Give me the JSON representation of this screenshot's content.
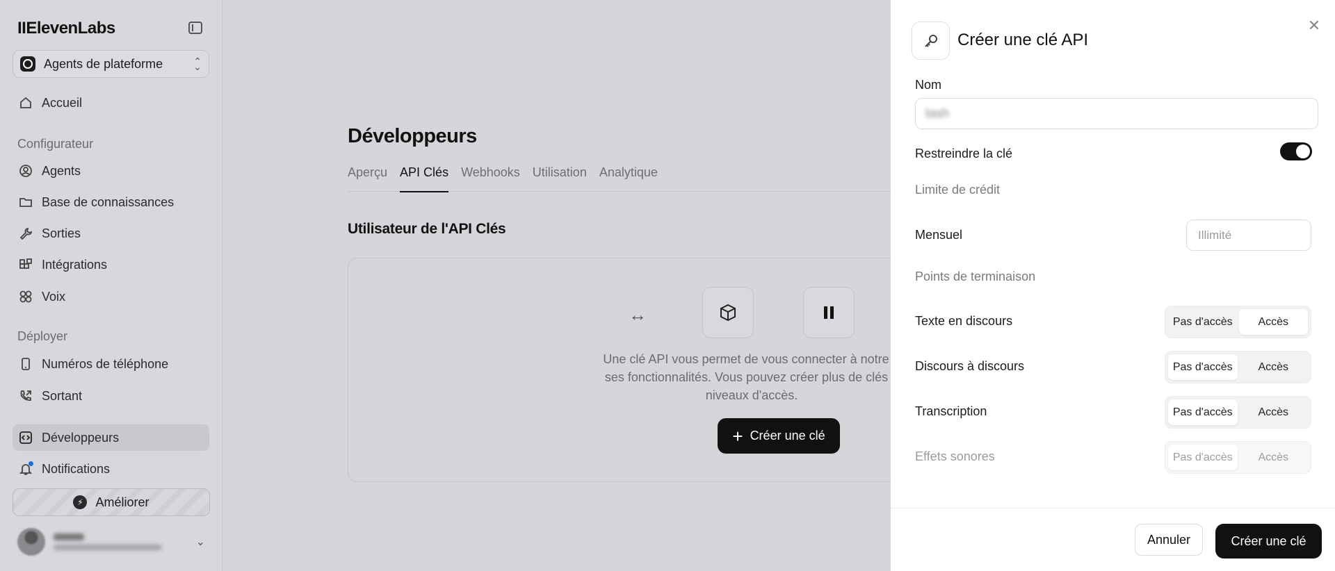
{
  "sidebar": {
    "logo": "IIElevenLabs",
    "workspace": "Agents de plateforme",
    "home": "Accueil",
    "section_config": "Configurateur",
    "items_config": [
      "Agents",
      "Base de connaissances",
      "Sorties",
      "Intégrations",
      "Voix"
    ],
    "section_deploy": "Déployer",
    "items_deploy": [
      "Numéros de téléphone",
      "Sortant"
    ],
    "developers": "Développeurs",
    "notifications": "Notifications",
    "upgrade": "Améliorer"
  },
  "main": {
    "title": "Développeurs",
    "tabs": [
      "Aperçu",
      "API Clés",
      "Webhooks",
      "Utilisation",
      "Analytique"
    ],
    "active_tab": "API Clés",
    "section_title": "Utilisateur de l'API Clés",
    "empty_line1": "Une clé API vous permet de vous connecter à notre A",
    "empty_line2": "ses fonctionnalités. Vous pouvez créer plus de clés a",
    "empty_line3": "niveaux d'accès.",
    "create_button": "Créer une clé",
    "arrow": "↔"
  },
  "drawer": {
    "title": "Créer une clé API",
    "name_label": "Nom",
    "name_value": "tash",
    "restrict_label": "Restreindre la clé",
    "restrict_on": true,
    "credit_limit_label": "Limite de crédit",
    "monthly_label": "Mensuel",
    "monthly_placeholder": "Illimité",
    "endpoints_label": "Points de terminaison",
    "endpoints": [
      {
        "label": "Texte en discours",
        "selected": "Accès",
        "disabled": false
      },
      {
        "label": "Discours à discours",
        "selected": "Pas d'accès",
        "disabled": false
      },
      {
        "label": "Transcription",
        "selected": "Pas d'accès",
        "disabled": false
      },
      {
        "label": "Effets sonores",
        "selected": "Pas d'accès",
        "disabled": true
      }
    ],
    "opt_no_access": "Pas d'accès",
    "opt_access": "Accès",
    "cancel": "Annuler",
    "confirm": "Créer une clé"
  }
}
